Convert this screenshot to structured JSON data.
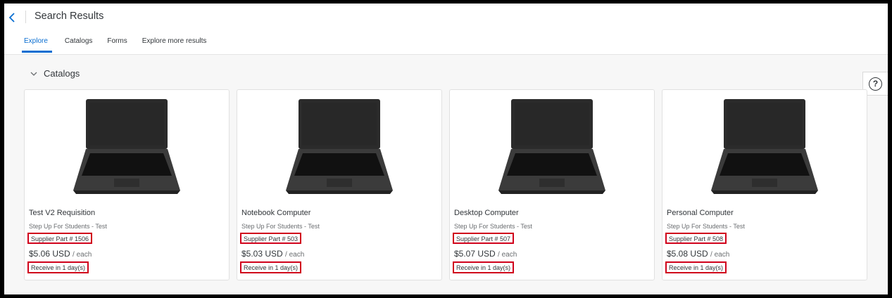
{
  "header": {
    "title": "Search Results",
    "tabs": [
      {
        "label": "Explore",
        "active": true
      },
      {
        "label": "Catalogs"
      },
      {
        "label": "Forms"
      },
      {
        "label": "Explore more results"
      }
    ]
  },
  "section": {
    "title": "Catalogs",
    "help_label": "?"
  },
  "cards": [
    {
      "title": "Test V2 Requisition",
      "supplier": "Step Up For Students - Test",
      "part": "Supplier Part # 1506",
      "price": "$5.06 USD",
      "unit": "/ each",
      "delivery": "Receive in 1 day(s)"
    },
    {
      "title": "Notebook Computer",
      "supplier": "Step Up For Students - Test",
      "part": "Supplier Part # 503",
      "price": "$5.03 USD",
      "unit": "/ each",
      "delivery": "Receive in 1 day(s)"
    },
    {
      "title": "Desktop Computer",
      "supplier": "Step Up For Students - Test",
      "part": "Supplier Part # 507",
      "price": "$5.07 USD",
      "unit": "/ each",
      "delivery": "Receive in 1 day(s)"
    },
    {
      "title": "Personal Computer",
      "supplier": "Step Up For Students - Test",
      "part": "Supplier Part # 508",
      "price": "$5.08 USD",
      "unit": "/ each",
      "delivery": "Receive in 1 day(s)"
    }
  ],
  "icons": {
    "back": "chevron-left-icon",
    "collapse": "chevron-down-icon",
    "help": "help-icon",
    "product": "laptop-image"
  },
  "colors": {
    "accent": "#0a6ed1",
    "highlight_border": "#d0021b",
    "background": "#f7f7f7"
  }
}
